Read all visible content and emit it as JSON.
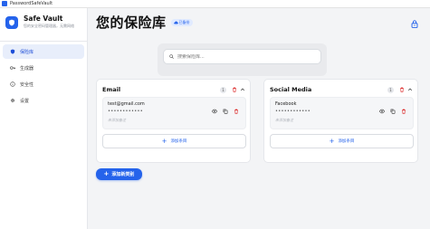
{
  "window": {
    "title": "PasswordSafeVault"
  },
  "sidebar": {
    "brand_name": "Safe Vault",
    "brand_tagline": "您的安全密码管理器，无需网络",
    "items": [
      {
        "label": "保险库",
        "icon": "shield-icon",
        "active": true
      },
      {
        "label": "生成器",
        "icon": "key-icon",
        "active": false
      },
      {
        "label": "安全性",
        "icon": "info-icon",
        "active": false
      },
      {
        "label": "设置",
        "icon": "gear-icon",
        "active": false
      }
    ]
  },
  "header": {
    "title": "您的保险库",
    "cloud_badge": "已备份"
  },
  "search": {
    "placeholder": "搜索保险库..."
  },
  "categories": [
    {
      "title": "Email",
      "count": "1",
      "entries": [
        {
          "name": "test@gmail.com",
          "secret": "••••••••••••",
          "note": "未添加备注"
        }
      ],
      "add_label": "添加条目"
    },
    {
      "title": "Social Media",
      "count": "1",
      "entries": [
        {
          "name": "Facebook",
          "secret": "••••••••••••",
          "note": "未添加备注"
        }
      ],
      "add_label": "添加条目"
    }
  ],
  "add_category_label": "添加新类别",
  "colors": {
    "accent": "#2563eb",
    "danger": "#dc2626",
    "active_bg": "#e8eefb"
  }
}
